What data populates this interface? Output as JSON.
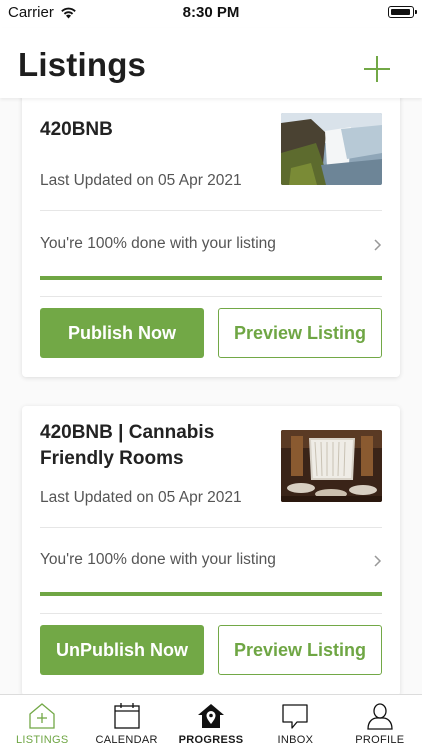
{
  "status_bar": {
    "carrier": "Carrier",
    "time": "8:30 PM"
  },
  "header": {
    "title": "Listings",
    "add_icon": "plus-icon"
  },
  "colors": {
    "accent": "#72a846",
    "progress_track": "#e4ead9"
  },
  "listings": [
    {
      "title": "420BNB",
      "thumbnail": "waterfall-photo",
      "updated": "Last Updated on 05 Apr 2021",
      "progress_text": "You're 100% done with your listing",
      "progress_percent": 100,
      "primary_button": "Publish Now",
      "secondary_button": "Preview Listing"
    },
    {
      "title": "420BNB | Cannabis Friendly Rooms",
      "thumbnail": "restaurant-photo",
      "updated": "Last Updated on 05 Apr 2021",
      "progress_text": "You're 100% done with your listing",
      "progress_percent": 100,
      "primary_button": "UnPublish Now",
      "secondary_button": "Preview Listing"
    }
  ],
  "tabbar": {
    "tabs": [
      {
        "label": "LISTINGS",
        "icon": "home-plus-icon",
        "active": true
      },
      {
        "label": "CALENDAR",
        "icon": "calendar-icon",
        "active": false
      },
      {
        "label": "PROGRESS",
        "icon": "house-pin-icon",
        "active": false
      },
      {
        "label": "INBOX",
        "icon": "chat-bubble-icon",
        "active": false
      },
      {
        "label": "PROFILE",
        "icon": "person-icon",
        "active": false
      }
    ]
  }
}
